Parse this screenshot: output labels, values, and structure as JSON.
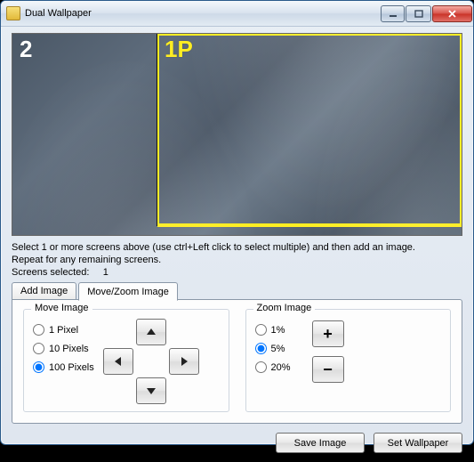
{
  "window": {
    "title": "Dual Wallpaper"
  },
  "screens": {
    "left_label": "2",
    "right_label": "1P"
  },
  "help": {
    "line1": "Select 1 or more screens above (use ctrl+Left click to select multiple) and then add an image.",
    "line2": "Repeat for any remaining screens.",
    "selected_label": "Screens selected:",
    "selected_count": "1"
  },
  "tabs": {
    "add": "Add Image",
    "move": "Move/Zoom Image"
  },
  "move": {
    "legend": "Move Image",
    "opt1": "1 Pixel",
    "opt10": "10 Pixels",
    "opt100": "100 Pixels"
  },
  "zoom": {
    "legend": "Zoom Image",
    "opt1": "1%",
    "opt5": "5%",
    "opt20": "20%",
    "plus": "+",
    "minus": "−"
  },
  "footer": {
    "save": "Save Image",
    "set": "Set Wallpaper"
  }
}
